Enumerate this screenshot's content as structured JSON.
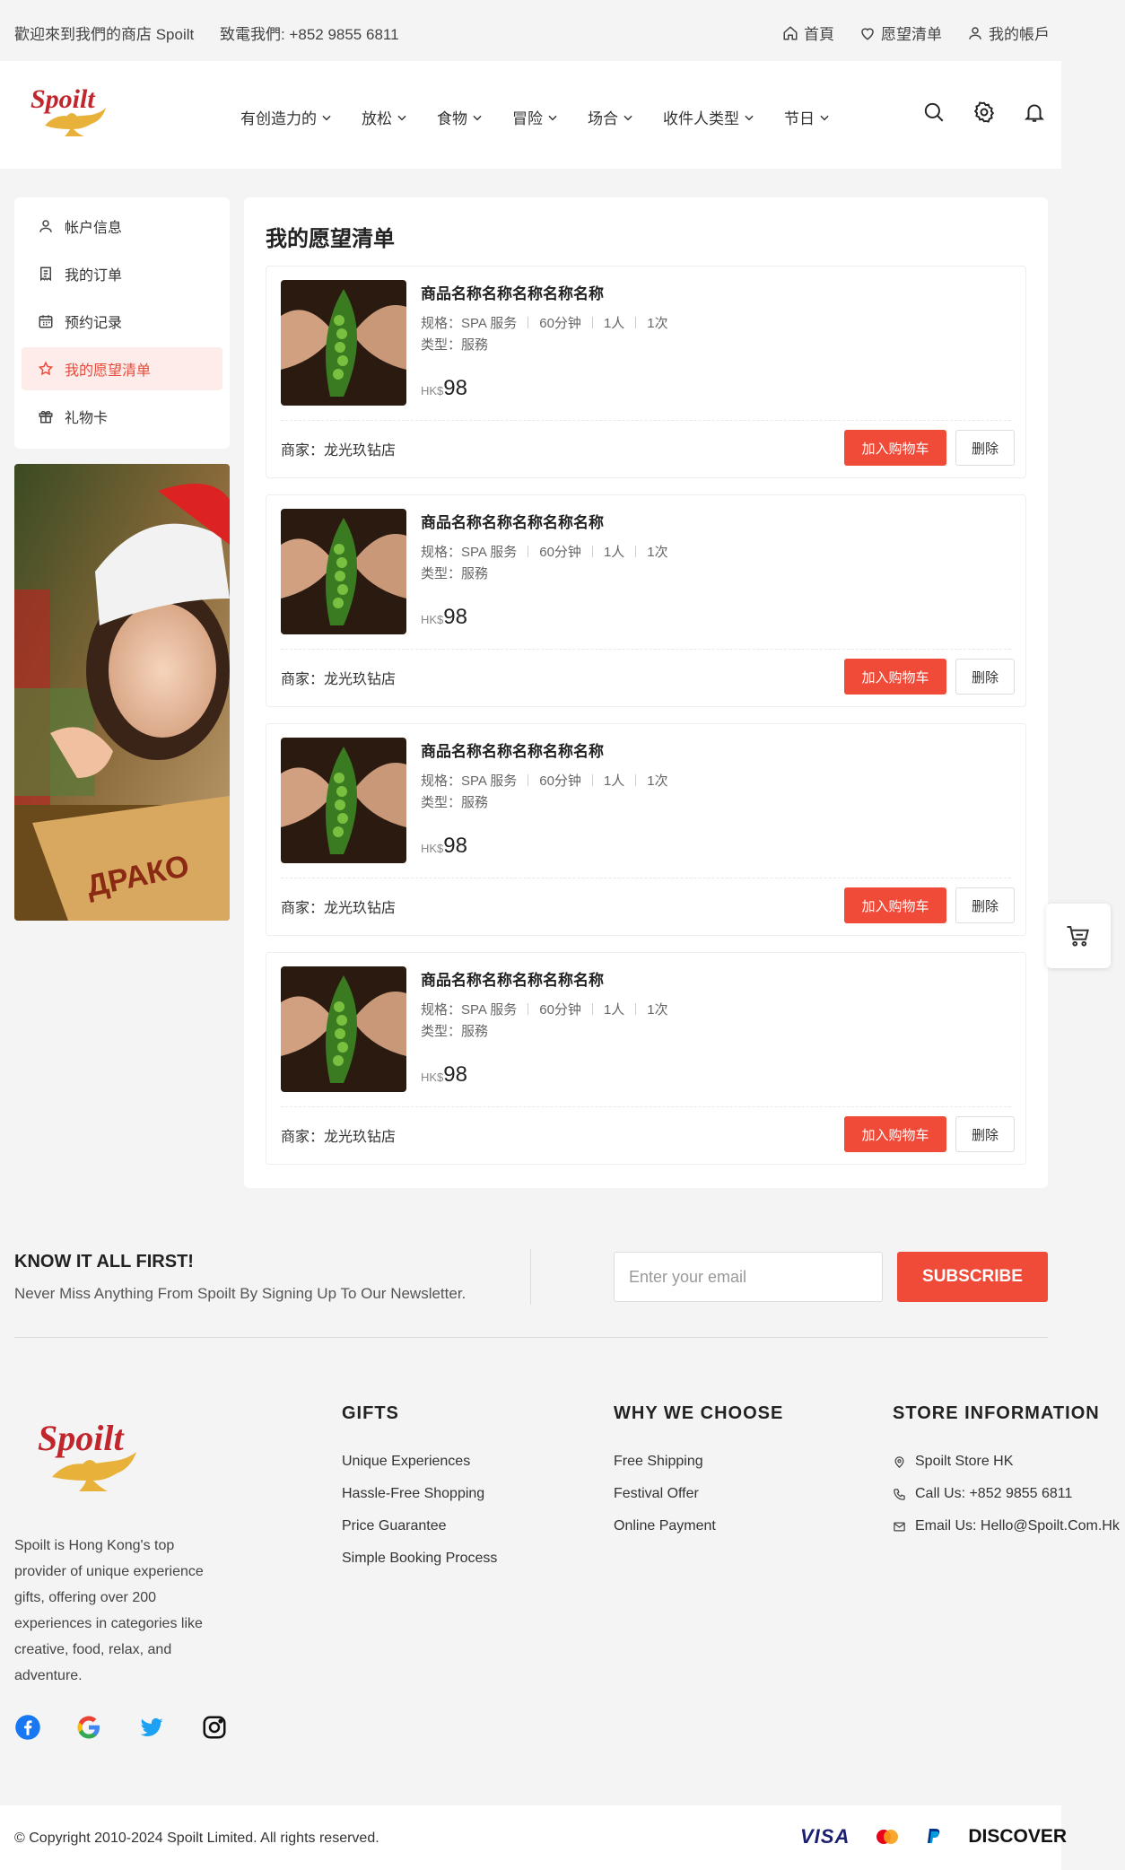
{
  "topbar": {
    "welcome": "歡迎來到我們的商店 Spoilt",
    "phone": "致電我們: +852 9855 6811",
    "links": {
      "home": "首頁",
      "wishlist": "愿望清单",
      "account": "我的帳戶"
    }
  },
  "header": {
    "logo_text": "Spoilt",
    "nav": [
      "有创造力的",
      "放松",
      "食物",
      "冒险",
      "场合",
      "收件人类型",
      "节日"
    ]
  },
  "sidebar": {
    "items": [
      {
        "label": "帐户信息",
        "icon": "user-icon"
      },
      {
        "label": "我的订单",
        "icon": "receipt-icon"
      },
      {
        "label": "预约记录",
        "icon": "calendar-icon"
      },
      {
        "label": "我的愿望清单",
        "icon": "star-icon",
        "active": true
      },
      {
        "label": "礼物卡",
        "icon": "gift-icon"
      }
    ]
  },
  "wishlist": {
    "title": "我的愿望清单",
    "items": [
      {
        "name": "商品名称名称名称名称名称",
        "spec_label": "规格：SPA 服务",
        "duration": "60分钟",
        "people": "1人",
        "times": "1次",
        "type": "类型：服務",
        "currency": "HK$",
        "price": "98",
        "merchant": "商家：龙光玖钻店",
        "add_label": "加入购物车",
        "delete_label": "删除"
      },
      {
        "name": "商品名称名称名称名称名称",
        "spec_label": "规格：SPA 服务",
        "duration": "60分钟",
        "people": "1人",
        "times": "1次",
        "type": "类型：服務",
        "currency": "HK$",
        "price": "98",
        "merchant": "商家：龙光玖钻店",
        "add_label": "加入购物车",
        "delete_label": "删除"
      },
      {
        "name": "商品名称名称名称名称名称",
        "spec_label": "规格：SPA 服务",
        "duration": "60分钟",
        "people": "1人",
        "times": "1次",
        "type": "类型：服務",
        "currency": "HK$",
        "price": "98",
        "merchant": "商家：龙光玖钻店",
        "add_label": "加入购物车",
        "delete_label": "删除"
      },
      {
        "name": "商品名称名称名称名称名称",
        "spec_label": "规格：SPA 服务",
        "duration": "60分钟",
        "people": "1人",
        "times": "1次",
        "type": "类型：服務",
        "currency": "HK$",
        "price": "98",
        "merchant": "商家：龙光玖钻店",
        "add_label": "加入购物车",
        "delete_label": "删除"
      }
    ]
  },
  "newsletter": {
    "title": "KNOW IT ALL FIRST!",
    "subtitle": "Never Miss Anything From Spoilt By Signing Up To Our Newsletter.",
    "placeholder": "Enter your email",
    "button": "SUBSCRIBE"
  },
  "footer": {
    "about": "Spoilt is Hong Kong's top provider of unique experience gifts, offering over 200 experiences in categories like creative, food, relax, and adventure.",
    "gifts": {
      "title": "GIFTS",
      "links": [
        "Unique Experiences",
        "Hassle-Free Shopping",
        "Price Guarantee",
        "Simple Booking Process"
      ]
    },
    "why": {
      "title": "WHY WE CHOOSE",
      "links": [
        "Free Shipping",
        "Festival Offer",
        "Online Payment"
      ]
    },
    "store": {
      "title": "STORE INFORMATION",
      "name": "Spoilt Store HK",
      "call": "Call Us: +852 9855 6811",
      "email": "Email Us: Hello@Spoilt.Com.Hk"
    },
    "social": [
      "facebook-icon",
      "google-icon",
      "twitter-icon",
      "instagram-icon"
    ],
    "copyright": "© Copyright 2010-2024 Spoilt Limited. All rights reserved.",
    "payments": {
      "visa": "VISA",
      "discover": "DISCOVER"
    }
  },
  "colors": {
    "accent": "#f04a38",
    "active_bg": "#fdecea",
    "logo_red": "#c0262c",
    "lamp_gold": "#e8b13a"
  }
}
